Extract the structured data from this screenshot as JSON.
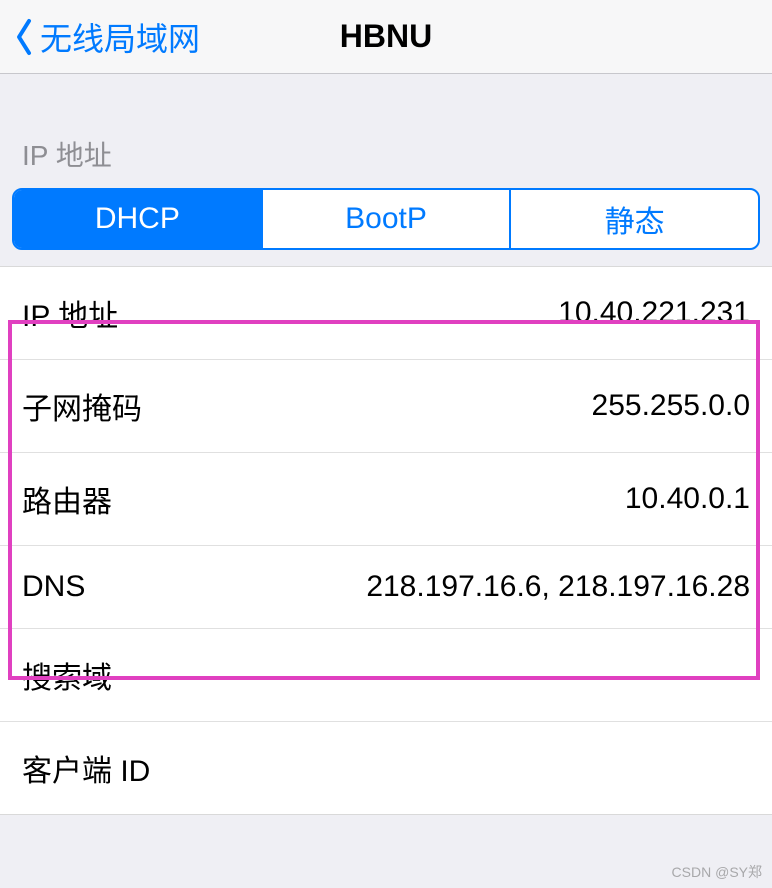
{
  "nav": {
    "back_label": "无线局域网",
    "title": "HBNU"
  },
  "section": {
    "ip_header": "IP 地址"
  },
  "segmented": {
    "items": [
      "DHCP",
      "BootP",
      "静态"
    ],
    "active_index": 0
  },
  "fields": {
    "ip_label": "IP 地址",
    "ip_value": "10.40.221.231",
    "subnet_label": "子网掩码",
    "subnet_value": "255.255.0.0",
    "router_label": "路由器",
    "router_value": "10.40.0.1",
    "dns_label": "DNS",
    "dns_value": "218.197.16.6, 218.197.16.28",
    "search_domain_label": "搜索域",
    "search_domain_value": "",
    "client_id_label": "客户端 ID",
    "client_id_value": ""
  },
  "watermark": "CSDN @SY郑"
}
